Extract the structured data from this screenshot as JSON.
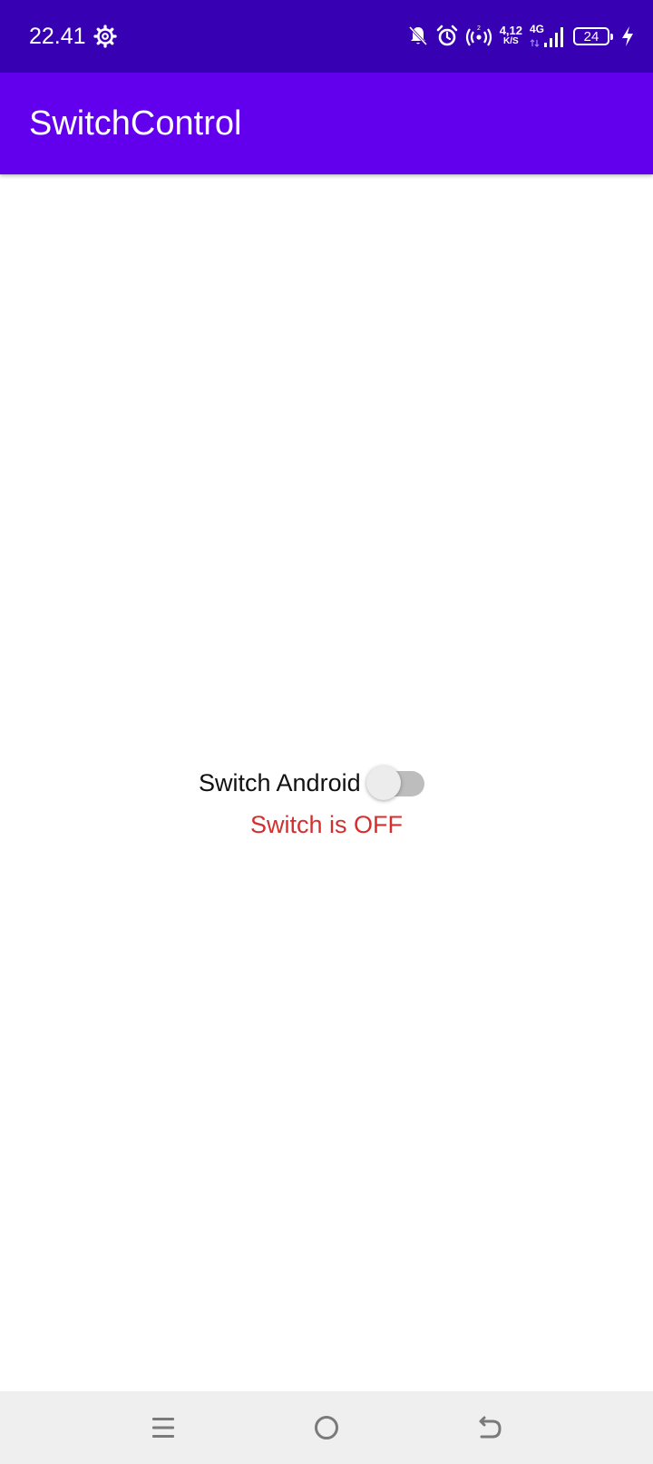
{
  "status_bar": {
    "time": "22.41",
    "net_speed_value": "4,12",
    "net_speed_unit": "K/S",
    "network_type": "4G",
    "battery_level": "24",
    "icons": [
      "gear-icon",
      "bell-off-icon",
      "alarm-icon",
      "hotspot-icon",
      "signal-icon",
      "charging-icon"
    ],
    "background_color": "#3700B3"
  },
  "app_bar": {
    "title": "SwitchControl",
    "background_color": "#6200EE"
  },
  "main": {
    "switch": {
      "label": "Switch Android",
      "checked": false
    },
    "status_text": "Switch is OFF",
    "status_color": "#D32F2F"
  },
  "nav_bar": {
    "buttons": [
      "menu-icon",
      "home-icon",
      "back-icon"
    ]
  }
}
